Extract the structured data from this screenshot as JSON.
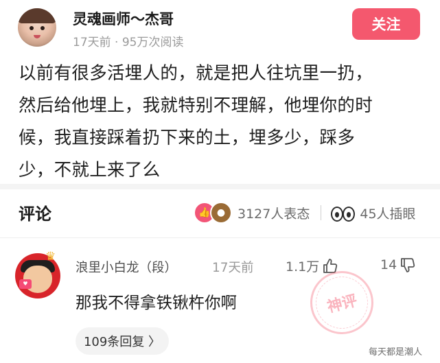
{
  "author": {
    "name": "灵魂画师～杰哥",
    "meta": "17天前 · 95万次阅读",
    "follow_label": "关注"
  },
  "post": {
    "lines": [
      "以前有很多活埋人的，就是把人往坑里一扔，",
      "然后给他埋上，我就特别不理解，他埋你的时",
      "候，我直接踩着扔下来的土，埋多少，踩多",
      "少，不就上来了么"
    ]
  },
  "comments_section": {
    "title": "评论",
    "reactions_label": "3127人表态",
    "peek_label": "45人插眼"
  },
  "comment": {
    "user": "浪里小白龙（段）",
    "time": "17天前",
    "likes": "1.1万",
    "dislikes": "14",
    "text": "那我不得拿铁锹杵你啊",
    "stamp_text": "神评",
    "replies_label": "109条回复 〉"
  },
  "watermark": "每天都是潮人",
  "colors": {
    "accent": "#f4586e",
    "muted": "#9a9a9a"
  }
}
